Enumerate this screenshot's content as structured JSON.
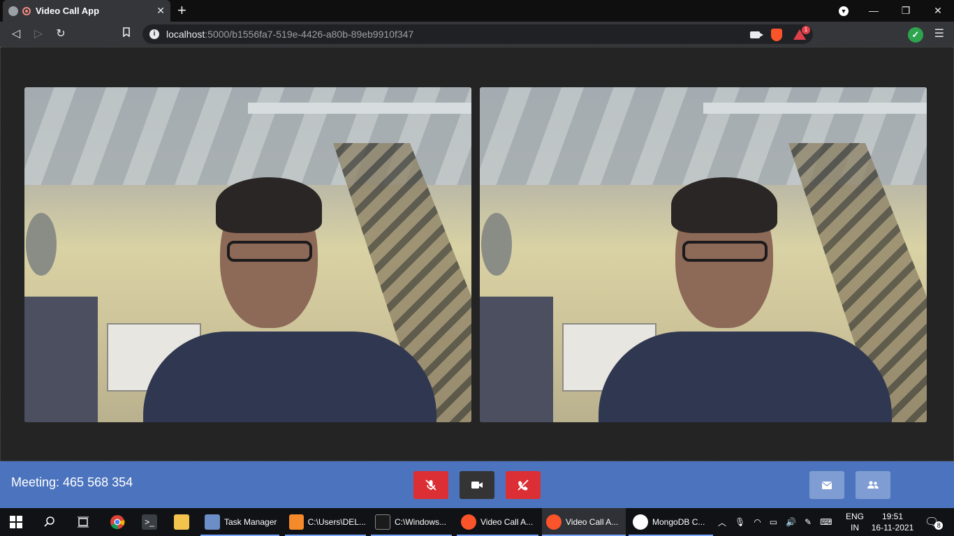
{
  "browser": {
    "tab_title": "Video Call App",
    "tab_close": "✕",
    "new_tab": "+",
    "url_host": "localhost",
    "url_path": ":5000/b1556fa7-519e-4426-a80b-89eb9910f347",
    "rewards_badge": "1",
    "window_buttons": {
      "minimize": "—",
      "maximize": "❐",
      "close": "✕"
    }
  },
  "app": {
    "meeting_label": "Meeting: 465 568 354",
    "colors": {
      "bar": "#4c74be",
      "danger": "#dc2f35",
      "neutral": "#343434",
      "secondary": "#7f9dd3"
    }
  },
  "taskbar": {
    "apps": [
      {
        "label": "Task Manager"
      },
      {
        "label": "C:\\Users\\DEL..."
      },
      {
        "label": "C:\\Windows..."
      },
      {
        "label": "Video Call A..."
      },
      {
        "label": "Video Call A..."
      },
      {
        "label": "MongoDB C..."
      }
    ],
    "language": "ENG",
    "region": "IN",
    "time": "19:51",
    "date": "16-11-2021",
    "notification_count": "8"
  }
}
